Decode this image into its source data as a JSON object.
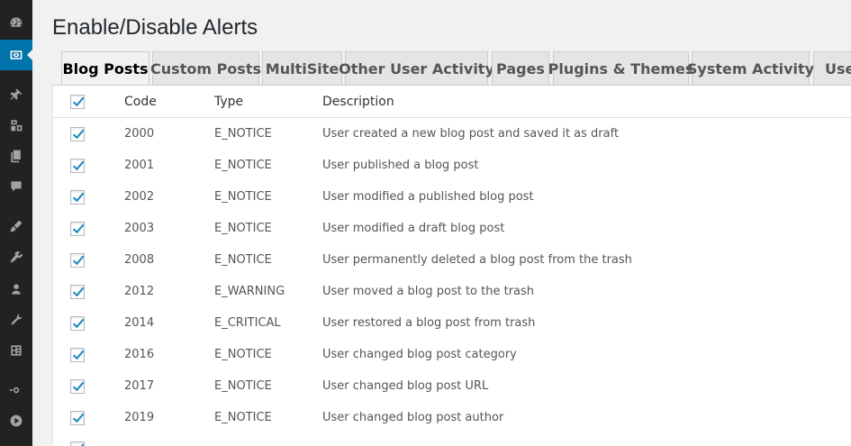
{
  "page": {
    "title": "Enable/Disable Alerts"
  },
  "sidebar": {
    "items": [
      {
        "icon": "dashboard-icon"
      },
      {
        "icon": "alerts-eye-icon",
        "active": true
      },
      {
        "icon": "pin-icon"
      },
      {
        "icon": "media-icon"
      },
      {
        "icon": "pages-icon"
      },
      {
        "icon": "comments-icon"
      },
      {
        "icon": "appearance-icon"
      },
      {
        "icon": "plugins-icon"
      },
      {
        "icon": "users-icon"
      },
      {
        "icon": "tools-icon"
      },
      {
        "icon": "settings-icon"
      },
      {
        "icon": "collapse-icon"
      },
      {
        "icon": "play-icon"
      }
    ]
  },
  "tabs": [
    {
      "label": "Blog Posts",
      "active": true
    },
    {
      "label": "Custom Posts"
    },
    {
      "label": "MultiSite"
    },
    {
      "label": "Other User Activity"
    },
    {
      "label": "Pages"
    },
    {
      "label": "Plugins & Themes"
    },
    {
      "label": "System Activity"
    },
    {
      "label": "User"
    }
  ],
  "table": {
    "headers": {
      "code": "Code",
      "type": "Type",
      "description": "Description"
    },
    "header_checked": true,
    "rows": [
      {
        "checked": true,
        "code": "2000",
        "type": "E_NOTICE",
        "description": "User created a new blog post and saved it as draft"
      },
      {
        "checked": true,
        "code": "2001",
        "type": "E_NOTICE",
        "description": "User published a blog post"
      },
      {
        "checked": true,
        "code": "2002",
        "type": "E_NOTICE",
        "description": "User modified a published blog post"
      },
      {
        "checked": true,
        "code": "2003",
        "type": "E_NOTICE",
        "description": "User modified a draft blog post"
      },
      {
        "checked": true,
        "code": "2008",
        "type": "E_NOTICE",
        "description": "User permanently deleted a blog post from the trash"
      },
      {
        "checked": true,
        "code": "2012",
        "type": "E_WARNING",
        "description": "User moved a blog post to the trash"
      },
      {
        "checked": true,
        "code": "2014",
        "type": "E_CRITICAL",
        "description": "User restored a blog post from trash"
      },
      {
        "checked": true,
        "code": "2016",
        "type": "E_NOTICE",
        "description": "User changed blog post category"
      },
      {
        "checked": true,
        "code": "2017",
        "type": "E_NOTICE",
        "description": "User changed blog post URL"
      },
      {
        "checked": true,
        "code": "2019",
        "type": "E_NOTICE",
        "description": "User changed blog post author"
      }
    ]
  },
  "colors": {
    "sidebar_bg": "#222222",
    "active_menu": "#0073aa",
    "checkmark": "#1e8cbe"
  }
}
